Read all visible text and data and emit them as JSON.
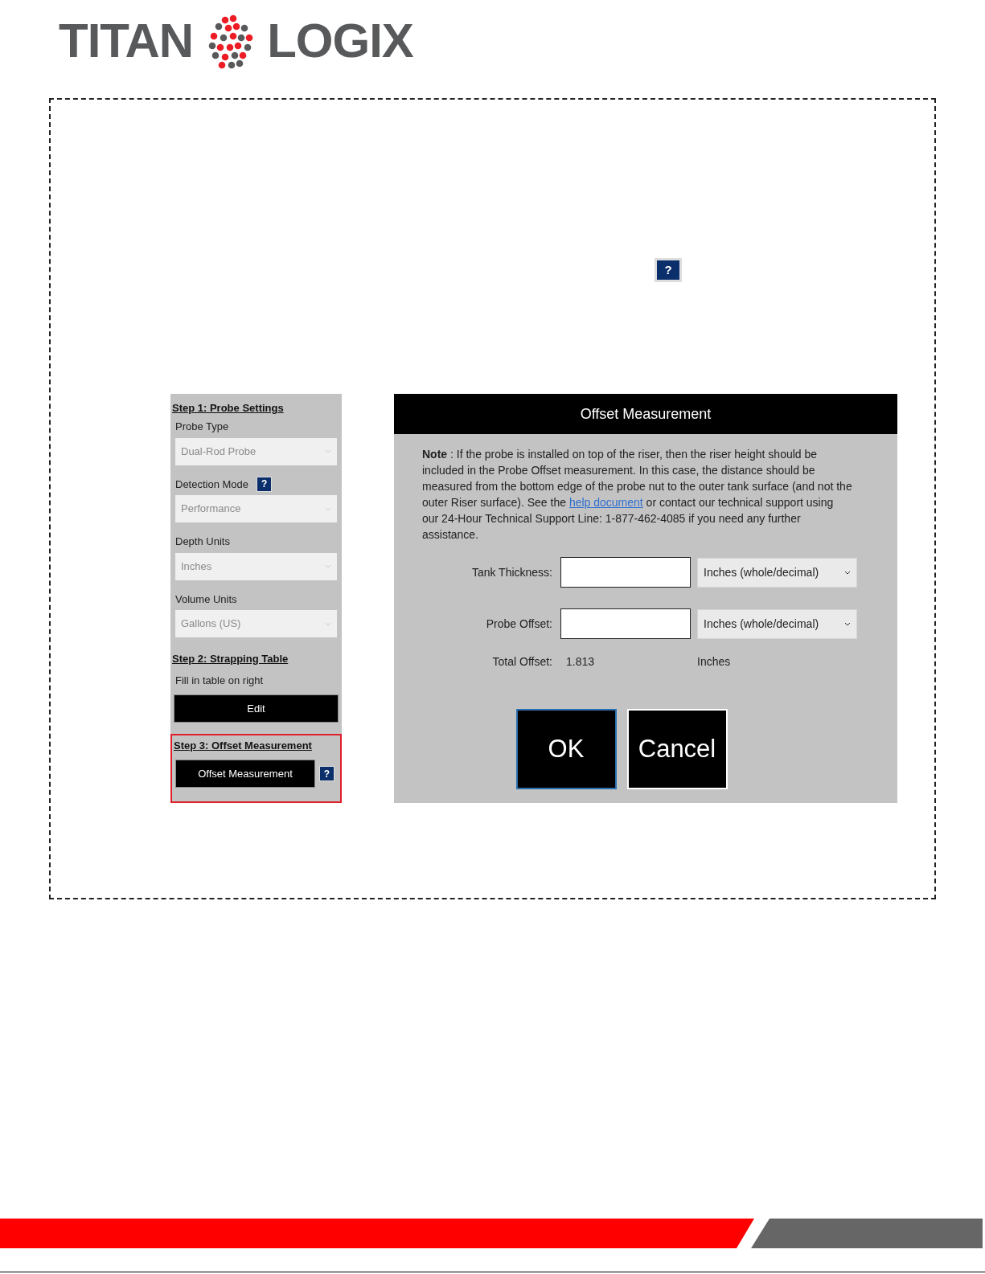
{
  "logo": {
    "left": "TITAN",
    "right": "LOGIX"
  },
  "help_icon": {
    "label": "?"
  },
  "left_panel": {
    "sections": [
      {
        "heading": "Step 1: Probe Settings",
        "highlighted": false,
        "items": [
          {
            "kind": "select",
            "label": "Probe Type",
            "value": "Dual-Rod Probe",
            "help": false
          },
          {
            "kind": "select",
            "label": "Detection Mode",
            "value": "Performance",
            "help": true,
            "help_label": "?"
          },
          {
            "kind": "select",
            "label": "Depth Units",
            "value": "Inches",
            "help": false
          },
          {
            "kind": "select",
            "label": "Volume Units",
            "value": "Gallons (US)",
            "help": false
          }
        ]
      },
      {
        "heading": "Step 2: Strapping Table",
        "highlighted": false,
        "items": [
          {
            "kind": "text",
            "label": "Fill in table on right"
          },
          {
            "kind": "button",
            "label": "Edit",
            "help": false
          }
        ]
      },
      {
        "heading": "Step 3: Offset Measurement",
        "highlighted": true,
        "items": [
          {
            "kind": "button",
            "label": "Offset Measurement",
            "help": true,
            "help_label": "?"
          }
        ]
      }
    ]
  },
  "dialog": {
    "title": "Offset Measurement",
    "note": "**Note** : If the probe is installed on top of the riser, then the riser height should be included in the Probe Offset measurement. In this case, the distance should be measured from the bottom edge of the probe nut to the outer tank surface (and not the outer Riser surface). See the",
    "link": "help document",
    "note_end": "or contact our technical support using our 24-Hour Technical Support Line: 1-877-462-4085 if you need any further assistance.",
    "fields": [
      {
        "label": "Tank Thickness:",
        "unit": "Inches (whole/decimal)"
      },
      {
        "label": "Probe Offset:",
        "unit": "Inches (whole/decimal)"
      }
    ],
    "total": {
      "label": "Total Offset:",
      "value": "1.813",
      "unit": "Inches"
    },
    "buttons": [
      {
        "label": "OK",
        "selected": true
      },
      {
        "label": "Cancel",
        "selected": false
      }
    ]
  }
}
